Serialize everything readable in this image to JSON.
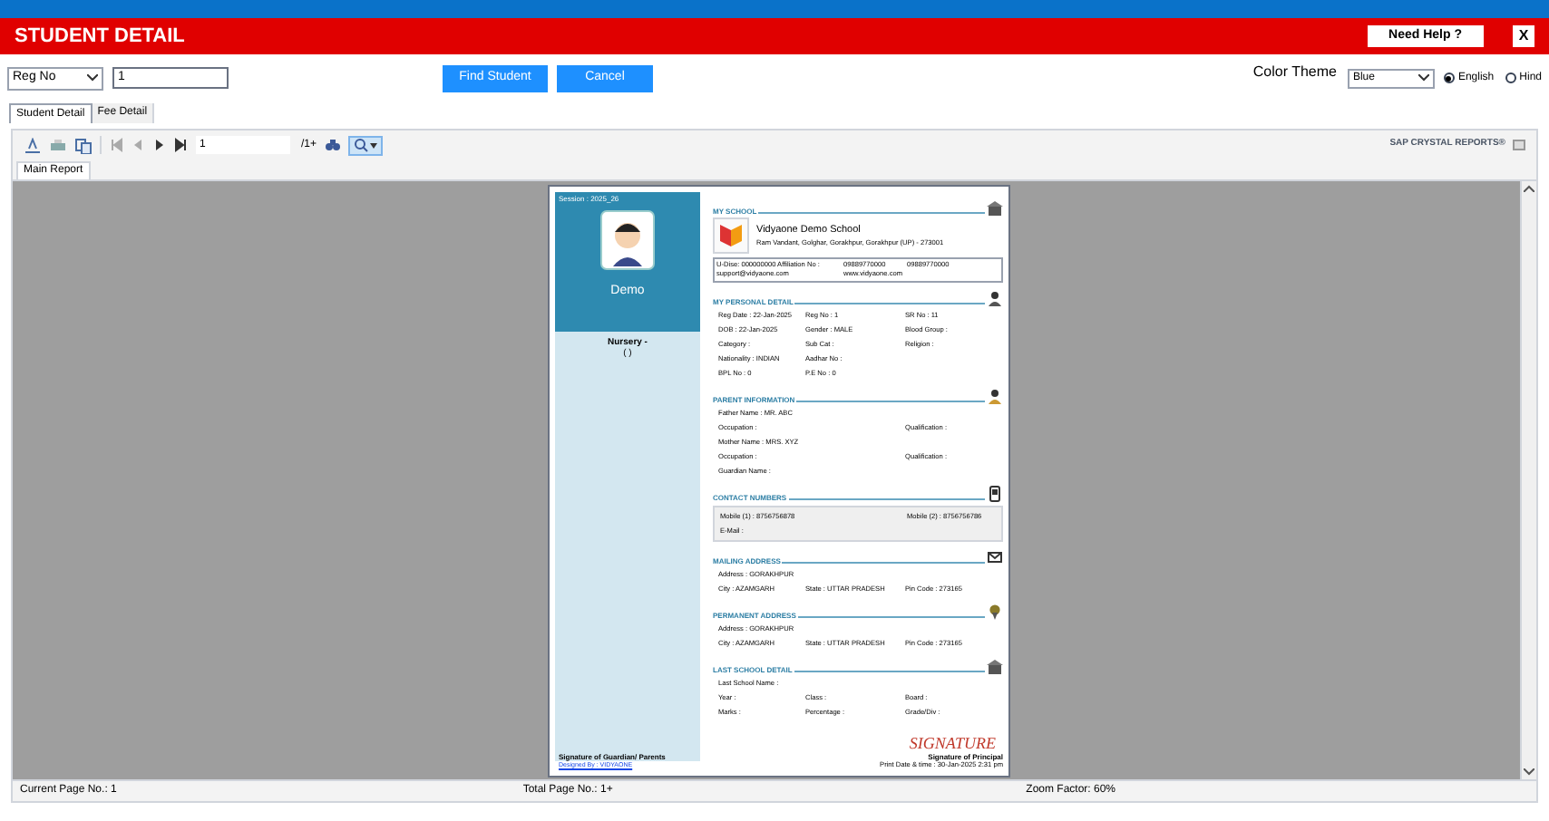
{
  "window": {
    "title": "STUDENT DETAIL",
    "help_button": "Need Help ?",
    "close_button": "X"
  },
  "search": {
    "field": "Reg No",
    "value": "1",
    "buttons": [
      "Find Student",
      "Cancel"
    ]
  },
  "theme": {
    "label": "Color Theme",
    "value": "Blue",
    "languages": [
      {
        "label": "English",
        "selected": true
      },
      {
        "label": "Hind",
        "selected": false
      }
    ]
  },
  "tabs": [
    {
      "label": "Student Detail",
      "selected": true
    },
    {
      "label": "Fee Detail",
      "selected": false
    }
  ],
  "viewer": {
    "page_input": "1",
    "page_total": "/1+",
    "zoom_selected": true,
    "brand": "SAP CRYSTAL REPORTS®",
    "report_tab": "Main Report"
  },
  "report": {
    "session": "Session : 2025_26",
    "student_name": "Demo",
    "class": "Nursery -",
    "section": "( )",
    "school_heading": "MY SCHOOL",
    "school_name": "Vidyaone Demo School",
    "school_address": "Ram Vandant, Golghar, Gorakhpur, Gorakhpur (UP) - 273001",
    "school_contacts": [
      "U-Dise: 000000000  Affiliation No :",
      "09889770000",
      "09889770000",
      "support@vidyaone.com",
      "www.vidyaone.com"
    ],
    "sections": [
      {
        "title": "MY PERSONAL DETAIL",
        "kind": "person",
        "boxed": false,
        "rows": [
          [
            "Reg Date : 22-Jan-2025",
            "Reg No : 1",
            "SR No : 11"
          ],
          [
            "DOB : 22-Jan-2025",
            "Gender : MALE",
            "Blood Group :"
          ],
          [
            "Category :",
            "Sub Cat :",
            "Religion :"
          ],
          [
            "Nationality : INDIAN",
            "Aadhar No :"
          ],
          [
            "BPL No : 0",
            "P.E No : 0"
          ]
        ]
      },
      {
        "title": "PARENT INFORMATION",
        "kind": "parent",
        "boxed": false,
        "rows": [
          [
            "Father Name : MR. ABC"
          ],
          [
            "Occupation :",
            "",
            "Qualification :"
          ],
          [
            "Mother Name : MRS. XYZ"
          ],
          [
            "Occupation :",
            "",
            "Qualification :"
          ],
          [
            "Guardian Name :"
          ]
        ]
      },
      {
        "title": "CONTACT NUMBERS",
        "kind": "phone",
        "boxed": true,
        "rows": [
          [
            "Mobile (1) : 8756756878",
            "",
            "Mobile (2) : 8756756786"
          ],
          [
            "E-Mail :"
          ]
        ]
      },
      {
        "title": "MAILING ADDRESS",
        "kind": "mail",
        "boxed": false,
        "rows": [
          [
            "Address : GORAKHPUR"
          ],
          [
            "City : AZAMGARH",
            "State : UTTAR PRADESH",
            "Pin Code : 273165"
          ]
        ]
      },
      {
        "title": "PERMANENT ADDRESS",
        "kind": "pin",
        "boxed": false,
        "rows": [
          [
            "Address : GORAKHPUR"
          ],
          [
            "City : AZAMGARH",
            "State : UTTAR PRADESH",
            "Pin Code : 273165"
          ]
        ]
      },
      {
        "title": "LAST SCHOOL DETAIL",
        "kind": "school",
        "boxed": false,
        "rows": [
          [
            "Last School Name :"
          ],
          [
            "Year :",
            "Class :",
            "Board :"
          ],
          [
            "Marks :",
            "Percentage :",
            "Grade/Div :"
          ]
        ]
      }
    ],
    "guardian_signature": "Signature of Guardian/ Parents",
    "principal_signature": "Signature of Principal",
    "signature": "SIGNATURE",
    "designed_by": "Designed By : VIDYAONE",
    "print_date": "Print Date & time : 30-Jan-2025 2:31 pm"
  },
  "status_bar": [
    "Current Page No.: 1",
    "Total Page No.: 1+",
    "Zoom Factor: 60%"
  ]
}
